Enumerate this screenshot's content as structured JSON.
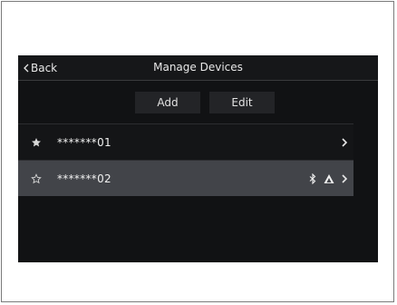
{
  "header": {
    "back_label": "Back",
    "title": "Manage Devices"
  },
  "actions": {
    "add_label": "Add",
    "edit_label": "Edit"
  },
  "devices": [
    {
      "name": "*******01",
      "favorite": true,
      "icons": [
        "chevron-right-icon"
      ]
    },
    {
      "name": "*******02",
      "favorite": false,
      "selected": true,
      "icons": [
        "bluetooth-icon",
        "android-auto-icon",
        "chevron-right-icon"
      ]
    }
  ],
  "colors": {
    "screen_bg": "#111214",
    "selected_row": "#424449",
    "button_bg": "#232427",
    "text": "#e6e6e6"
  }
}
